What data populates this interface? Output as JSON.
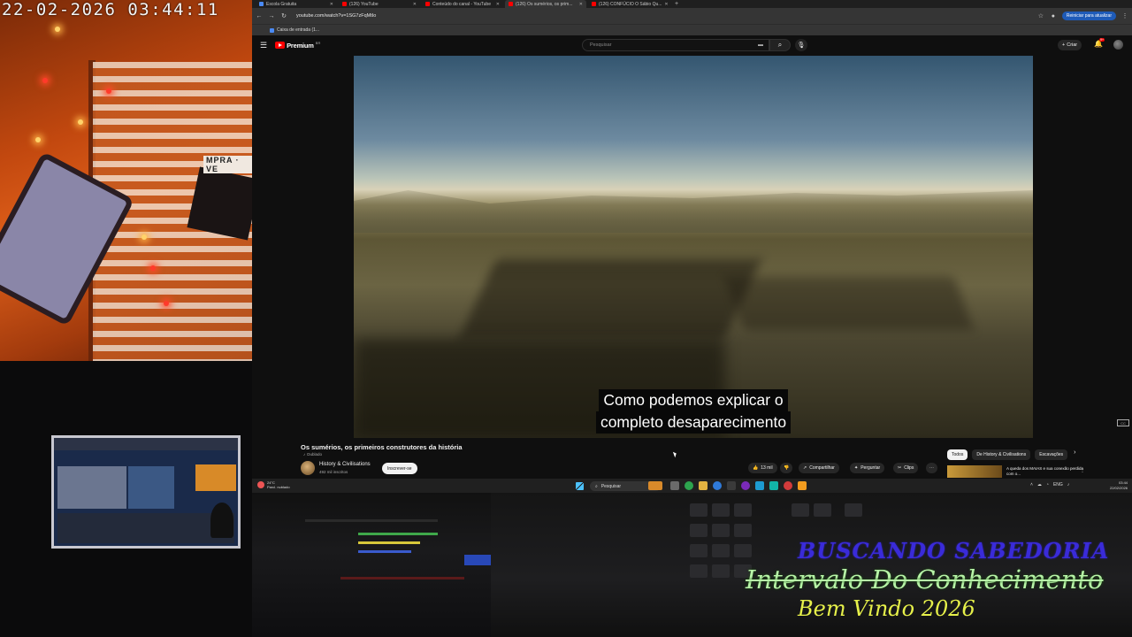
{
  "webcam": {
    "timestamp": "22-02-2026  03:44:11",
    "sign_text": "MPRA · VE"
  },
  "browser": {
    "tabs": [
      {
        "label": "Escola Gratuita",
        "icon": "tab-favicon"
      },
      {
        "label": "(126) YouTube",
        "icon": "youtube-icon"
      },
      {
        "label": "Conteúdo do canal - YouTube",
        "icon": "youtube-icon"
      },
      {
        "label": "(126) Os sumérios, os prim...",
        "icon": "youtube-icon",
        "active": true
      },
      {
        "label": "(126) CONFÚCIO O Sábio Qu...",
        "icon": "youtube-icon"
      }
    ],
    "new_tab": "+",
    "url": "youtube.com/watch?v=1SG7zFqMtIo",
    "update_button": "Reiniciar para atualizar",
    "bookmarks": [
      {
        "label": "Caixa de entrada (1..."
      }
    ]
  },
  "youtube": {
    "logo": "Premium",
    "logo_sup": "BR",
    "search_placeholder": "Pesquisar",
    "create_label": "Criar",
    "notifications_badge": "9+",
    "subtitle_lines": [
      "Como podemos explicar o",
      "completo desaparecimento"
    ],
    "video_title": "Os sumérios, os primeiros construtores da história",
    "dubbed_label": "Dublado",
    "channel_name": "History & Civilisations",
    "channel_subs": "492 mil inscritos",
    "subscribe_label": "Inscrever-se",
    "likes": "13 mil",
    "share_label": "Compartilhar",
    "ask_label": "Perguntar",
    "clips_label": "Clips",
    "chips": [
      "Todos",
      "De History & Civilisations",
      "Escavações"
    ],
    "rec_title": "A queda dos MAIAS e sua conexão perdida com o..."
  },
  "taskbar": {
    "weather_temp": "24°C",
    "weather_desc": "Parcl. nublado",
    "search_label": "Pesquisar",
    "lang": "ENG",
    "time": "03:44",
    "date": "22/02/2026"
  },
  "overlay": {
    "title": "BUSCANDO SABEDORIA",
    "subtitle": "Intervalo Do Conhecimento",
    "welcome": "Bem Vindo 2026"
  },
  "colors": {
    "yt_red": "#ff0000",
    "overlay_title": "#3a2bd9",
    "overlay_subtitle": "#b8f5a8",
    "overlay_welcome": "#e6f04a"
  }
}
